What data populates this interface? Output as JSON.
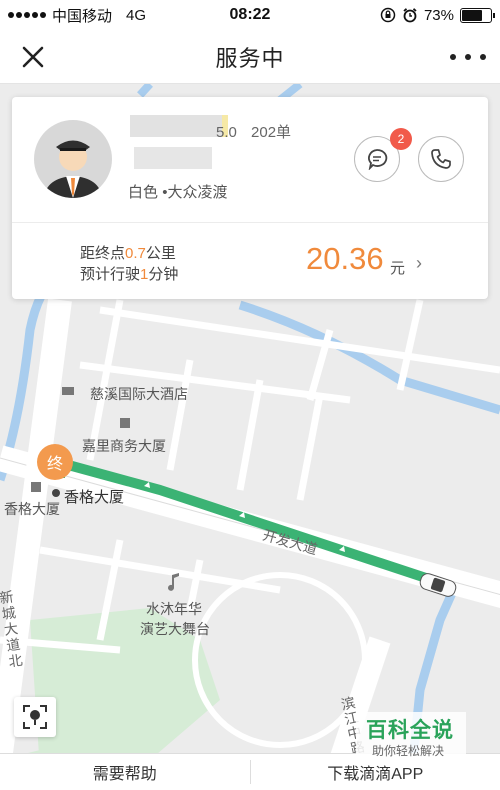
{
  "status_bar": {
    "carrier": "中国移动",
    "network": "4G",
    "time": "08:22",
    "battery_percent": "73%",
    "battery_level": 0.73
  },
  "nav": {
    "title": "服务中"
  },
  "driver": {
    "rating": "5.0",
    "orders": "202单",
    "car_color": "白色",
    "car_model": "•大众凌渡",
    "message_badge": "2"
  },
  "trip": {
    "distance_prefix": "距终点",
    "distance_value": "0.7",
    "distance_unit": "公里",
    "time_prefix": "预计行驶",
    "time_value": "1",
    "time_unit": "分钟",
    "fare": "20.36",
    "fare_unit": "元",
    "fare_arrow": "›"
  },
  "map": {
    "destination_pin": "终",
    "labels": {
      "hotel": "慈溪国际大酒店",
      "jiali": "嘉里商务大厦",
      "xiangge": "香格大厦",
      "xiangge_small": "香格大厦",
      "shuimu_1": "水沐年华",
      "shuimu_2": "演艺大舞台",
      "road_kaifa": "开发大道",
      "road_xincheng": "新城大道北",
      "road_bin": "滨江中路"
    }
  },
  "bottom_bar": {
    "help": "需要帮助",
    "download": "下载滴滴APP"
  },
  "watermark": {
    "title": "百科全说",
    "subtitle": "助你轻松解决"
  },
  "colors": {
    "accent": "#f08a3c",
    "route": "#3bb374",
    "badge": "#f15a4a",
    "water": "#a9cdee",
    "park": "#d6ecd6"
  }
}
